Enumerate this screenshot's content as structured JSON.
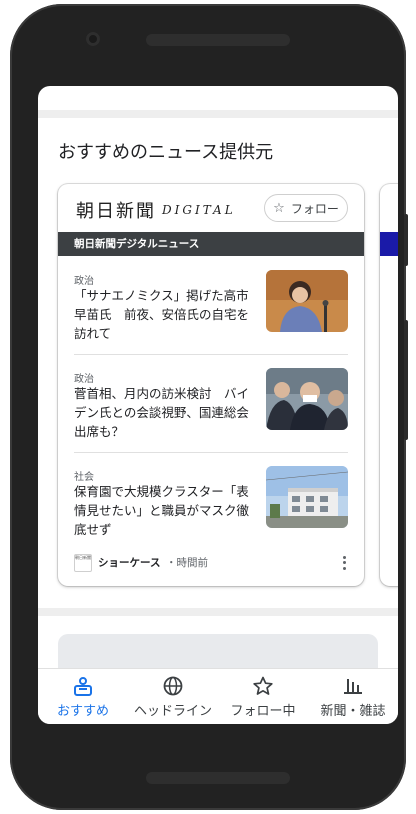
{
  "section": {
    "title": "おすすめのニュース提供元"
  },
  "publisher": {
    "logo_jp": "朝日新聞",
    "logo_en": "DIGITAL",
    "follow_label": "フォロー",
    "band_label": "朝日新聞デジタルニュース"
  },
  "articles": [
    {
      "category": "政治",
      "headline": "「サナエノミクス」掲げた高市早苗氏　前夜、安倍氏の自宅を訪れて"
    },
    {
      "category": "政治",
      "headline": "菅首相、月内の訪米検討　バイデン氏との会談視野、国連総会出席も？"
    },
    {
      "category": "社会",
      "headline": "保育園で大規模クラスター「表情見せたい」と職員がマスク徹底せず"
    }
  ],
  "footer": {
    "source": "ショーケース",
    "time": "・時間前",
    "icon_text": "朝日新聞"
  },
  "bottom_nav": [
    {
      "label": "おすすめ",
      "icon": "home-icon",
      "active": true
    },
    {
      "label": "ヘッドライン",
      "icon": "globe-icon",
      "active": false
    },
    {
      "label": "フォロー中",
      "icon": "star-icon",
      "active": false
    },
    {
      "label": "新聞・雑誌",
      "icon": "bar-chart-icon",
      "active": false
    }
  ],
  "colors": {
    "accent": "#1a73e8",
    "dark_band": "#3c4043",
    "peek_band": "#1a1aa8"
  }
}
